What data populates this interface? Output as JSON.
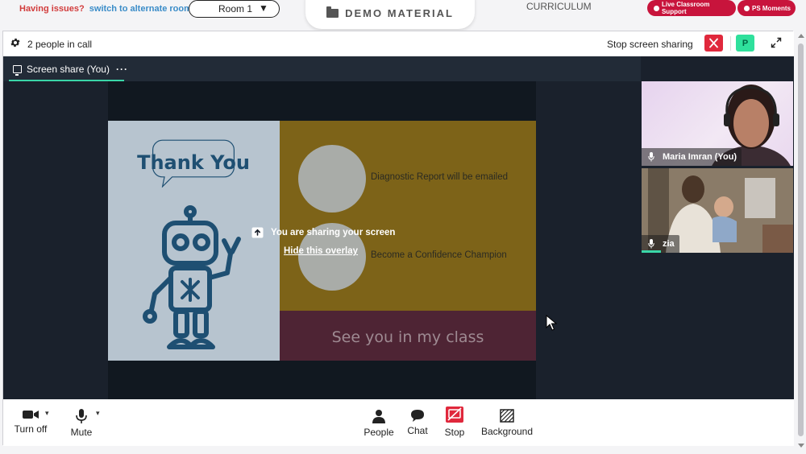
{
  "topbar": {
    "issues_text": "Having issues?",
    "alternate_room_link": "switch to alternate room",
    "room_select_value": "Room 1",
    "demo_material_label": "DEMO MATERIAL",
    "curriculum_label": "CURRICULUM",
    "live_support_label": "Live Classroom Support",
    "ps_moments_label": "PS Moments"
  },
  "call_header": {
    "people_count": "2 people in call",
    "stop_sharing_label": "Stop screen sharing",
    "avatar_initial": "P"
  },
  "share": {
    "tab_label": "Screen share (You)",
    "more_label": "···",
    "overlay_message": "You are sharing your screen",
    "hide_overlay_link": "Hide this overlay"
  },
  "slide": {
    "bubble_text": "Thank You",
    "item_1": "Diagnostic Report will be emailed",
    "item_2": "Become a Confidence Champion",
    "closing": "See you in my class"
  },
  "participants": [
    {
      "name": "Maria Imran (You)"
    },
    {
      "name": "zia"
    }
  ],
  "toolbar": {
    "camera_label": "Turn off",
    "mic_label": "Mute",
    "people_label": "People",
    "chat_label": "Chat",
    "stop_label": "Stop",
    "background_label": "Background"
  },
  "colors": {
    "accent_green": "#3ad6a8",
    "danger_red": "#e0283c",
    "support_pill": "#c8143c",
    "stage_dark": "#1a212c"
  }
}
